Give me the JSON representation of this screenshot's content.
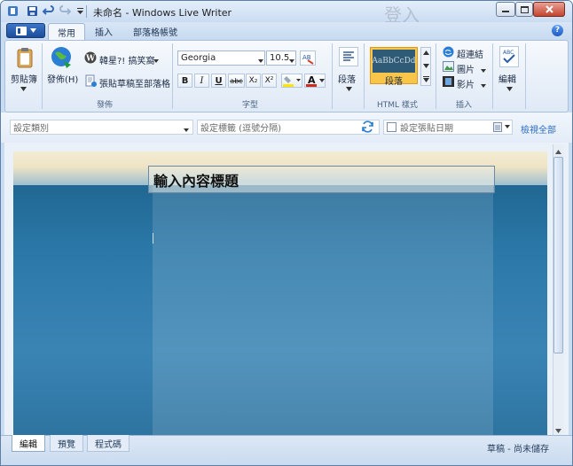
{
  "window": {
    "title": "未命名 - Windows Live Writer",
    "ghost_text": "登入"
  },
  "qat": [
    "app-icon",
    "save-icon",
    "undo-icon",
    "redo-icon",
    "customize-icon"
  ],
  "tabs": [
    {
      "label": "常用",
      "active": true
    },
    {
      "label": "插入",
      "active": false
    },
    {
      "label": "部落格帳號",
      "active": false
    }
  ],
  "ribbon": {
    "clipboard": {
      "label": "剪貼簿"
    },
    "publish": {
      "publish_label": "發佈(H)",
      "blog_name": "韓星?! 搞笑窩",
      "draft_label": "張貼草稿至部落格",
      "group_label": "發佈"
    },
    "font": {
      "family": "Georgia",
      "size": "10.5",
      "group_label": "字型",
      "bold": "B",
      "italic": "I",
      "underline": "U",
      "strike": "abc",
      "sub": "X₂",
      "sup": "X²",
      "font_color": "A"
    },
    "paragraph": {
      "label": "段落"
    },
    "html_style": {
      "preview": "AaBbCcDd",
      "label": "段落",
      "group_label": "HTML 樣式"
    },
    "insert": {
      "link": "超連結",
      "picture": "圖片",
      "video": "影片",
      "group_label": "插入"
    },
    "editing": {
      "label": "編輯"
    }
  },
  "properties": {
    "category_placeholder": "設定類別",
    "tags_placeholder": "設定標籤 (逗號分隔)",
    "date_label": "設定張貼日期",
    "view_all": "檢視全部"
  },
  "editor": {
    "title": "輸入內容標題"
  },
  "bottom_tabs": [
    {
      "label": "編輯",
      "active": true
    },
    {
      "label": "預覽",
      "active": false
    },
    {
      "label": "程式碼",
      "active": false
    }
  ],
  "status": "草稿 - 尚未儲存",
  "colors": {
    "accent": "#1d4d9b",
    "style_highlight": "#f9c64a",
    "editor_bg": "#2b78a8"
  }
}
